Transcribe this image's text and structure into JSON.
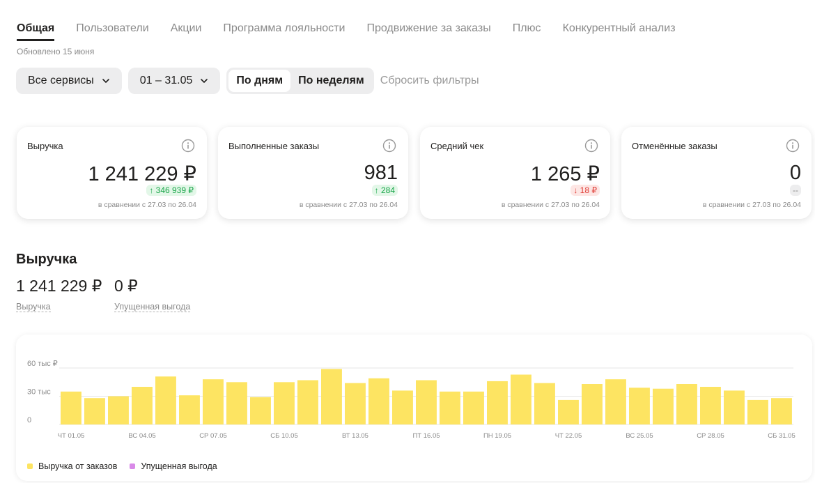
{
  "tabs": [
    "Общая",
    "Пользователи",
    "Акции",
    "Программа лояльности",
    "Продвижение за заказы",
    "Плюс",
    "Конкурентный анализ"
  ],
  "updated": "Обновлено 15 июня",
  "filters": {
    "service": "Все сервисы",
    "period": "01 – 31.05",
    "by_day": "По дням",
    "by_week": "По неделям",
    "reset": "Сбросить фильтры"
  },
  "cards": [
    {
      "title": "Выручка",
      "value": "1 241 229 ₽",
      "delta": "↑ 346 939 ₽",
      "trend": "up",
      "compare": "в сравнении с 27.03 по 26.04"
    },
    {
      "title": "Выполненные заказы",
      "value": "981",
      "delta": "↑ 284",
      "trend": "up",
      "compare": "в сравнении с 27.03 по 26.04"
    },
    {
      "title": "Средний чек",
      "value": "1 265 ₽",
      "delta": "↓ 18 ₽",
      "trend": "down",
      "compare": "в сравнении с 27.03 по 26.04"
    },
    {
      "title": "Отменённые заказы",
      "value": "0",
      "delta": "--",
      "trend": "none",
      "compare": "в сравнении с 27.03 по 26.04"
    }
  ],
  "revenue_section": {
    "title": "Выручка",
    "revenue_value": "1 241 229 ₽",
    "revenue_label": "Выручка",
    "lost_value": "0 ₽",
    "lost_label": "Упущенная выгода"
  },
  "colors": {
    "bar": "#fde462",
    "lost": "#d98ae8",
    "up": "#1aa64a",
    "down": "#e0403a"
  },
  "chart_data": {
    "type": "bar",
    "y_tick_labels": [
      "60 тыс ₽",
      "30 тыс",
      "0"
    ],
    "ylim": [
      0,
      60000
    ],
    "x_tick_labels": [
      "ЧТ 01.05",
      "ВС 04.05",
      "СР 07.05",
      "СБ 10.05",
      "ВТ 13.05",
      "ПТ 16.05",
      "ПН 19.05",
      "ЧТ 22.05",
      "ВС 25.05",
      "СР 28.05",
      "СБ 31.05"
    ],
    "categories": [
      "01.05",
      "02.05",
      "03.05",
      "04.05",
      "05.05",
      "06.05",
      "07.05",
      "08.05",
      "09.05",
      "10.05",
      "11.05",
      "12.05",
      "13.05",
      "14.05",
      "15.05",
      "16.05",
      "17.05",
      "18.05",
      "19.05",
      "20.05",
      "21.05",
      "22.05",
      "23.05",
      "24.05",
      "25.05",
      "26.05",
      "27.05",
      "28.05",
      "29.05",
      "30.05",
      "31.05"
    ],
    "series": [
      {
        "name": "Выручка от заказов",
        "values": [
          35000,
          28000,
          30000,
          40000,
          51000,
          31000,
          48000,
          45000,
          29000,
          45000,
          47000,
          59000,
          44000,
          49000,
          36000,
          47000,
          35000,
          35000,
          46000,
          53000,
          44000,
          26000,
          43000,
          48000,
          39000,
          38000,
          43000,
          40000,
          36000,
          26000,
          28000
        ]
      },
      {
        "name": "Упущенная выгода",
        "values": [
          0,
          0,
          0,
          0,
          0,
          0,
          0,
          0,
          0,
          0,
          0,
          0,
          0,
          0,
          0,
          0,
          0,
          0,
          0,
          0,
          0,
          0,
          0,
          0,
          0,
          0,
          0,
          0,
          0,
          0,
          0
        ]
      }
    ],
    "grid": true,
    "legend_position": "bottom-left"
  }
}
